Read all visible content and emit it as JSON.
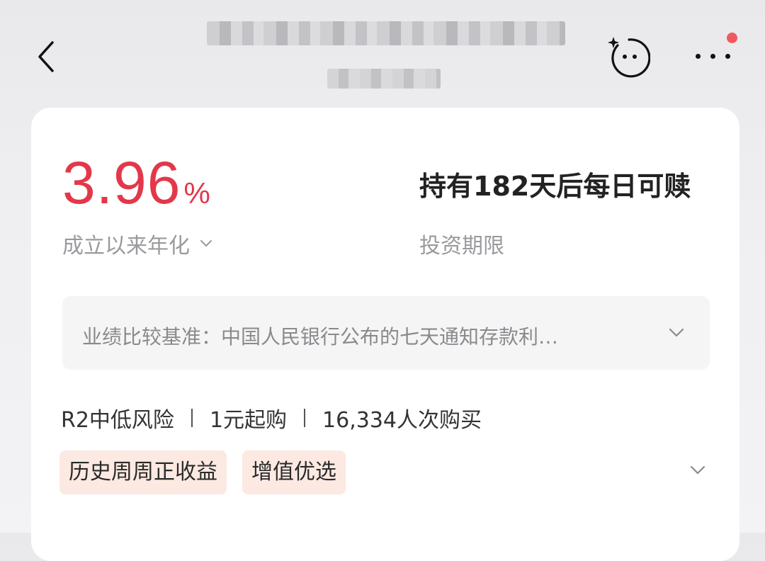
{
  "header": {
    "title": "",
    "subtitle": "",
    "icons": [
      "back-arrow-icon",
      "ai-assistant-face-icon",
      "more-dots-icon"
    ]
  },
  "product": {
    "rate_value": "3.96",
    "rate_unit": "%",
    "rate_label": "成立以来年化",
    "term_value": "持有182天后每日可赎",
    "term_label": "投资期限",
    "benchmark": "业绩比较基准：中国人民银行公布的七天通知存款利…",
    "risk": "R2中低风险",
    "min_purchase": "1元起购",
    "buyers": "16,334人次购买",
    "tags": [
      "历史周周正收益",
      "增值优选"
    ]
  },
  "colors": {
    "accent_red": "#e3384a",
    "notify_dot": "#f05a5e",
    "tag_bg": "#fce9e1"
  }
}
